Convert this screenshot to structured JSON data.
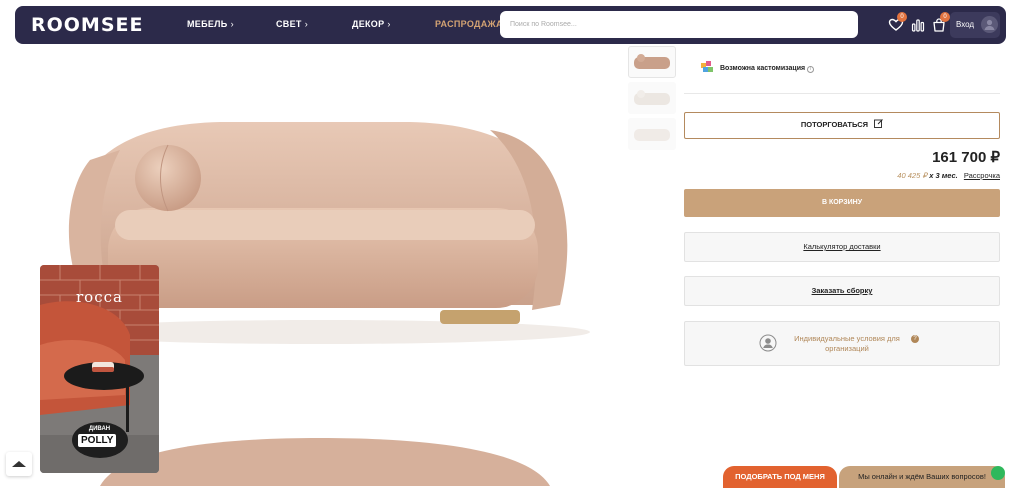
{
  "header": {
    "logo": "ROOMSEE",
    "nav": [
      {
        "label": "МЕБЕЛЬ",
        "chevron": "›"
      },
      {
        "label": "СВЕТ",
        "chevron": "›"
      },
      {
        "label": "ДЕКОР",
        "chevron": "›"
      },
      {
        "label": "РАСПРОДАЖА",
        "chevron": ""
      }
    ],
    "search_placeholder": "Поиск по Roomsee...",
    "favorites_count": "0",
    "cart_count": "0",
    "login_label": "Вход"
  },
  "product": {
    "customization_label": "Возможна кастомизация",
    "bargain_label": "ПОТОРГОВАТЬСЯ",
    "price": "161 700 ₽",
    "installment_amount": "40 425 ₽",
    "installment_term": "x 3 мес.",
    "installment_link": "Рассрочка",
    "cart_label": "В КОРЗИНУ",
    "delivery_label": "Калькулятор доставки",
    "assembly_label": "Заказать сборку",
    "org_label": "Индивидуальные условия для организаций"
  },
  "promo": {
    "brand": "rocca",
    "subtitle": "ДИВАН",
    "name": "POLLY"
  },
  "footer": {
    "pick_label": "ПОДОБРАТЬ ПОД МЕНЯ",
    "chat_label": "Мы онлайн и ждём Ваших вопросов!"
  },
  "colors": {
    "header_bg": "#2c2a4a",
    "accent": "#c9a27a",
    "sale": "#d4a373",
    "cta_orange": "#e2622f"
  }
}
